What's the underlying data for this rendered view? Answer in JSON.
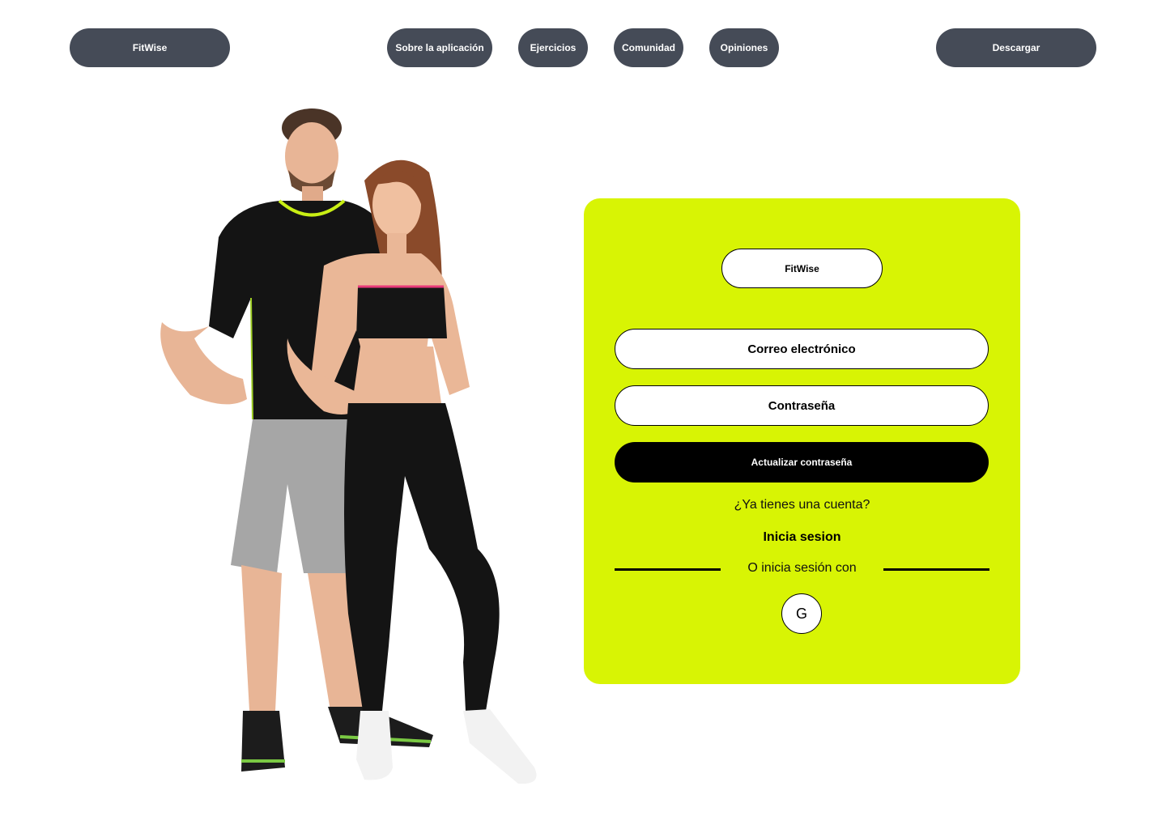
{
  "header": {
    "brand": "FitWise",
    "nav": {
      "about": "Sobre la aplicación",
      "exercises": "Ejercicios",
      "community": "Comunidad",
      "reviews": "Opiniones"
    },
    "download": "Descargar"
  },
  "card": {
    "logo": "FitWise",
    "email_placeholder": "Correo electrónico",
    "password_placeholder": "Contraseña",
    "submit": "Actualizar contraseña",
    "question": "¿Ya tienes una cuenta?",
    "login_link": "Inicia sesion",
    "divider_text": "O inicia sesión con",
    "google_label": "G"
  },
  "colors": {
    "accent": "#d8f404",
    "nav_pill": "#454b57",
    "button": "#000000"
  }
}
